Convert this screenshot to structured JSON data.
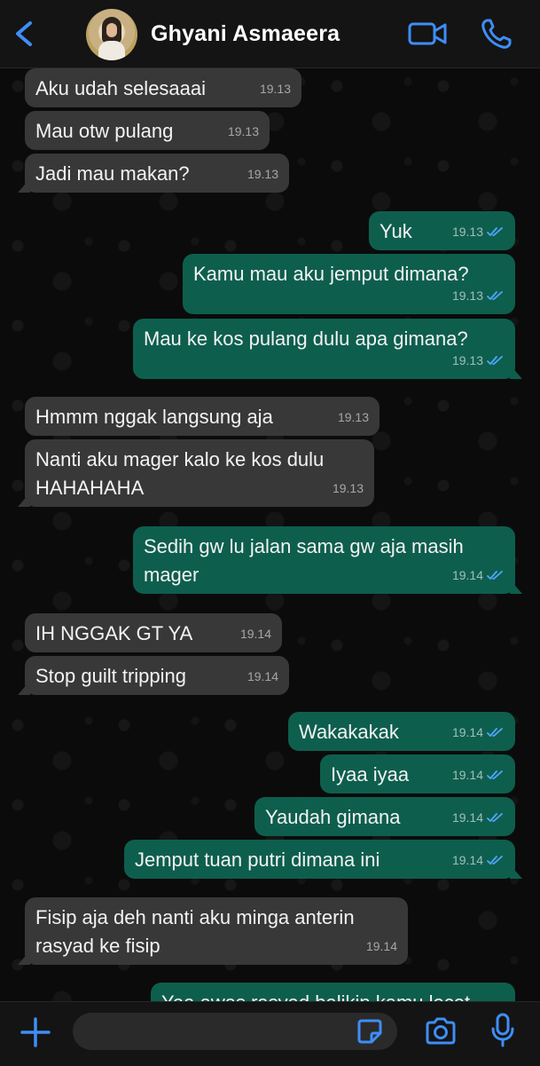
{
  "header": {
    "contact_name": "Ghyani Asmaeera",
    "icons": [
      "back-chevron-icon",
      "avatar",
      "video-call-icon",
      "phone-call-icon"
    ],
    "accent_color": "#3e8ef7"
  },
  "messages": [
    {
      "dir": "in",
      "text": "Aku udah selesaaai",
      "time": "19.13"
    },
    {
      "dir": "in",
      "text": "Mau otw pulang",
      "time": "19.13"
    },
    {
      "dir": "in",
      "text": "Jadi mau makan?",
      "time": "19.13"
    },
    {
      "dir": "out",
      "text": "Yuk",
      "time": "19.13",
      "status": "read"
    },
    {
      "dir": "out",
      "text": "Kamu mau aku jemput dimana?",
      "time": "19.13",
      "status": "read"
    },
    {
      "dir": "out",
      "text": "Mau ke kos pulang dulu apa gimana?",
      "time": "19.13",
      "status": "read"
    },
    {
      "dir": "in",
      "text": "Hmmm nggak langsung aja",
      "time": "19.13"
    },
    {
      "dir": "in",
      "text": "Nanti aku mager kalo ke kos dulu HAHAHAHA",
      "time": "19.13"
    },
    {
      "dir": "out",
      "text": "Sedih gw lu jalan sama gw aja masih mager",
      "time": "19.14",
      "status": "read"
    },
    {
      "dir": "in",
      "text": "IH NGGAK GT YA",
      "time": "19.14"
    },
    {
      "dir": "in",
      "text": "Stop guilt tripping",
      "time": "19.14"
    },
    {
      "dir": "out",
      "text": "Wakakakak",
      "time": "19.14",
      "status": "read"
    },
    {
      "dir": "out",
      "text": "Iyaa iyaa",
      "time": "19.14",
      "status": "read"
    },
    {
      "dir": "out",
      "text": "Yaudah gimana",
      "time": "19.14",
      "status": "read"
    },
    {
      "dir": "out",
      "text": "Jemput tuan putri dimana ini",
      "time": "19.14",
      "status": "read"
    },
    {
      "dir": "in",
      "text": "Fisip aja deh nanti aku minga anterin rasyad ke fisip",
      "time": "19.14"
    },
    {
      "dir": "out",
      "text": "Yaa awas rasyad balikin kamu lecet",
      "time": "",
      "status": ""
    }
  ],
  "composer": {
    "input_value": "",
    "icons": [
      "plus-icon",
      "sticker-icon",
      "camera-icon",
      "microphone-icon"
    ]
  },
  "colors": {
    "incoming_bubble": "#383838",
    "outgoing_bubble": "#0e5e4e",
    "read_ticks": "#4fa6ff",
    "background": "#0b0b0b"
  }
}
